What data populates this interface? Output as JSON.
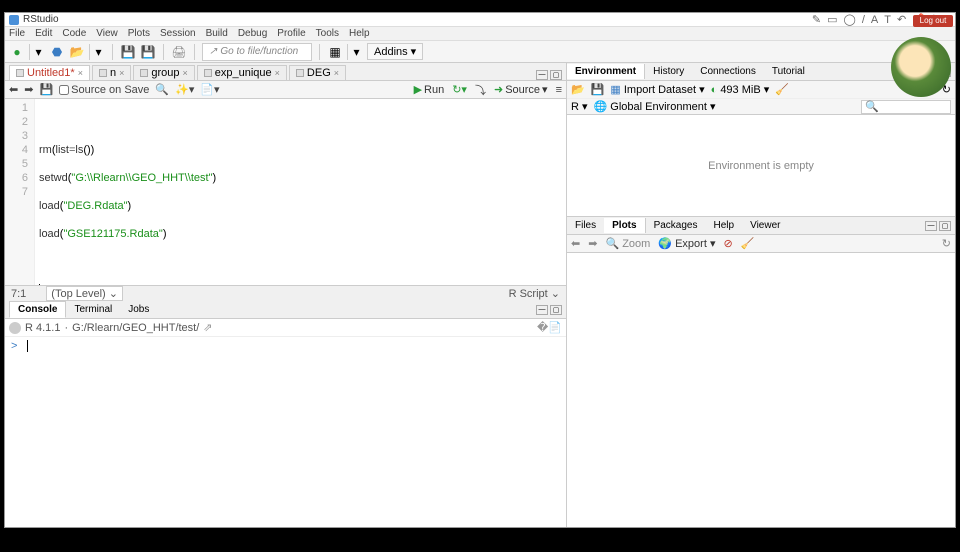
{
  "title": "RStudio",
  "menus": [
    "File",
    "Edit",
    "Code",
    "View",
    "Plots",
    "Session",
    "Build",
    "Debug",
    "Profile",
    "Tools",
    "Help"
  ],
  "goto_placeholder": "Go to file/function",
  "addins_label": "Addins",
  "editor_tabs": [
    {
      "label": "Untitled1*",
      "active": true,
      "dirty": true
    },
    {
      "label": "n",
      "active": false
    },
    {
      "label": "group",
      "active": false
    },
    {
      "label": "exp_unique",
      "active": false
    },
    {
      "label": "DEG",
      "active": false
    }
  ],
  "editor_toolbar": {
    "source_on_save": "Source on Save",
    "run": "Run",
    "source": "Source"
  },
  "code_lines": [
    {
      "n": 1,
      "raw": ""
    },
    {
      "n": 2,
      "raw": "rm(list=ls())"
    },
    {
      "n": 3,
      "raw": "setwd(\"G:\\\\Rlearn\\\\GEO_HHT\\\\test\")"
    },
    {
      "n": 4,
      "raw": "load(\"DEG.Rdata\")"
    },
    {
      "n": 5,
      "raw": "load(\"GSE121175.Rdata\")"
    },
    {
      "n": 6,
      "raw": ""
    },
    {
      "n": 7,
      "raw": ""
    }
  ],
  "editor_status": {
    "pos": "7:1",
    "scope": "(Top Level)",
    "lang": "R Script"
  },
  "console_tabs": [
    "Console",
    "Terminal",
    "Jobs"
  ],
  "console": {
    "version": "R 4.1.1",
    "path": "G:/Rlearn/GEO_HHT/test/",
    "prompt": ">"
  },
  "env_tabs": [
    "Environment",
    "History",
    "Connections",
    "Tutorial"
  ],
  "env_toolbar": {
    "import": "Import Dataset",
    "mem": "493 MiB"
  },
  "env_scope": {
    "lang": "R",
    "scope": "Global Environment"
  },
  "env_empty": "Environment is empty",
  "plots_tabs": [
    "Files",
    "Plots",
    "Packages",
    "Help",
    "Viewer"
  ],
  "plots_toolbar": {
    "zoom": "Zoom",
    "export": "Export"
  },
  "login_badge": "Log out"
}
